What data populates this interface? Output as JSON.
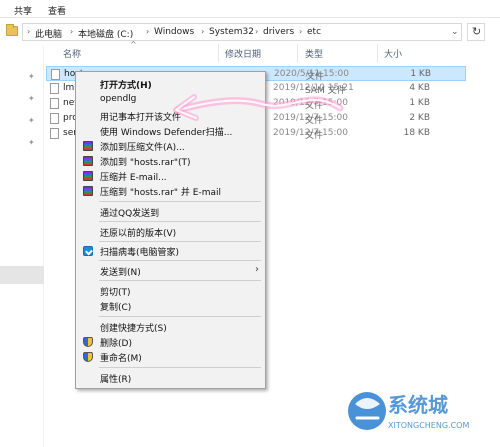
{
  "ribbon": {
    "tabs": [
      "共享",
      "查看"
    ]
  },
  "address": {
    "crumbs": [
      "此电脑",
      "本地磁盘 (C:)",
      "Windows",
      "System32",
      "drivers",
      "etc"
    ],
    "search_glyph": "↻"
  },
  "columns": {
    "name": "名称",
    "date": "修改日期",
    "type": "类型",
    "size": "大小"
  },
  "files": [
    {
      "name": "hosts",
      "date": "2020/5/11 15:00",
      "type": "文件",
      "size": "1 KB",
      "selected": true
    },
    {
      "name": "lmhosts.sam",
      "date": "2019/12/10 15:21",
      "type": "SAM 文件",
      "size": "4 KB",
      "selected": false
    },
    {
      "name": "networks",
      "date": "2019/12/7 15:00",
      "type": "文件",
      "size": "1 KB",
      "selected": false
    },
    {
      "name": "protocol",
      "date": "2019/12/7 15:00",
      "type": "文件",
      "size": "2 KB",
      "selected": false
    },
    {
      "name": "services",
      "date": "2019/12/7 15:00",
      "type": "文件",
      "size": "18 KB",
      "selected": false
    }
  ],
  "context_menu": {
    "open_with": "打开方式(H)",
    "opendlg": "opendlg",
    "open_notepad": "用记事本打开该文件",
    "defender": "使用 Windows Defender扫描...",
    "add_archive": "添加到压缩文件(A)...",
    "add_hosts_rar": "添加到 \"hosts.rar\"(T)",
    "compress_email": "压缩并 E-mail...",
    "compress_rar_email": "压缩到 \"hosts.rar\" 并 E-mail",
    "send_qq": "通过QQ发送到",
    "restore": "还原以前的版本(V)",
    "scan_virus": "扫描病毒(电脑管家)",
    "send_to": "发送到(N)",
    "cut": "剪切(T)",
    "copy": "复制(C)",
    "create_shortcut": "创建快捷方式(S)",
    "delete": "删除(D)",
    "rename": "重命名(M)",
    "properties": "属性(R)",
    "submenu_arrow": "›"
  },
  "watermark": {
    "brand": "系统城",
    "url": "XITONGCHENG.COM"
  },
  "colors": {
    "selection": "#cce8ff",
    "menu_bg": "#f2f2f2",
    "arrow": "#ff7fbf"
  }
}
